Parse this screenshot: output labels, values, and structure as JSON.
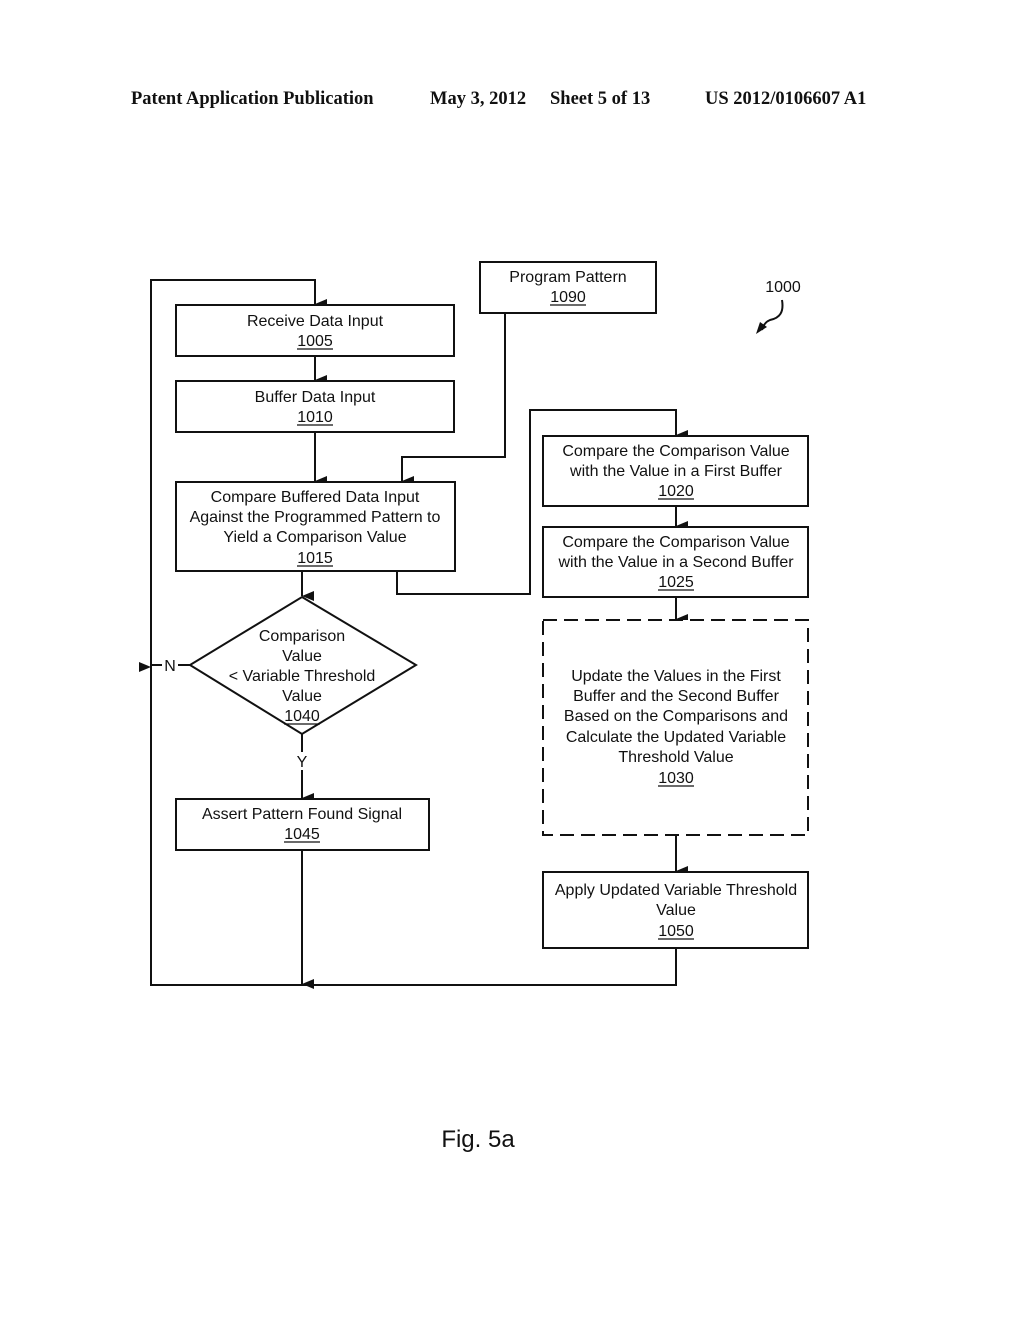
{
  "header": {
    "publication": "Patent Application Publication",
    "date": "May 3, 2012",
    "sheet": "Sheet 5 of 13",
    "number": "US 2012/0106607 A1"
  },
  "diagram": {
    "ref": "1000",
    "nodes": {
      "n1005": {
        "lines": [
          "Receive Data Input"
        ],
        "id": "1005"
      },
      "n1010": {
        "lines": [
          "Buffer Data Input"
        ],
        "id": "1010"
      },
      "n1090": {
        "lines": [
          "Program Pattern"
        ],
        "id": "1090"
      },
      "n1015": {
        "lines": [
          "Compare Buffered Data Input",
          "Against the Programmed Pattern to",
          "Yield a Comparison Value"
        ],
        "id": "1015"
      },
      "n1020": {
        "lines": [
          "Compare the Comparison Value",
          "with the Value in a First Buffer"
        ],
        "id": "1020"
      },
      "n1025": {
        "lines": [
          "Compare the Comparison Value",
          "with the Value in a Second Buffer"
        ],
        "id": "1025"
      },
      "n1040": {
        "lines": [
          "Comparison",
          "Value",
          "< Variable Threshold",
          "Value"
        ],
        "id": "1040"
      },
      "n1030": {
        "lines": [
          "Update the Values in the First",
          "Buffer and the Second Buffer",
          "Based on the Comparisons and",
          "Calculate the Updated Variable",
          "Threshold Value"
        ],
        "id": "1030"
      },
      "n1045": {
        "lines": [
          "Assert Pattern Found Signal"
        ],
        "id": "1045"
      },
      "n1050": {
        "lines": [
          "Apply Updated Variable Threshold",
          "Value"
        ],
        "id": "1050"
      }
    },
    "edge_labels": {
      "no": "N",
      "yes": "Y"
    }
  },
  "caption": "Fig. 5a"
}
